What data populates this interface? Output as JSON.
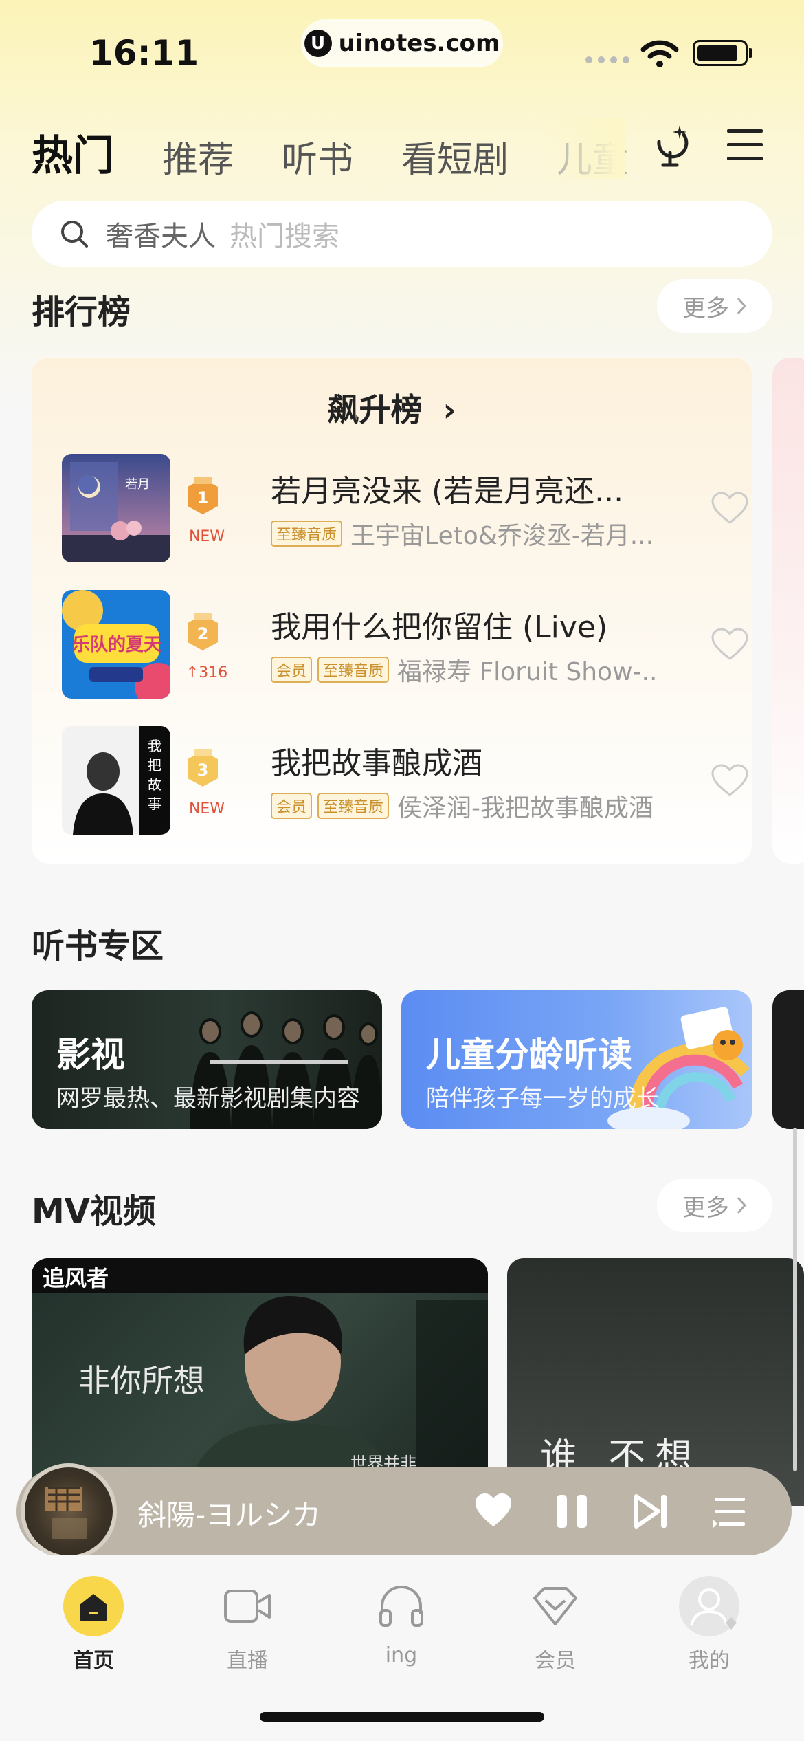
{
  "status_bar": {
    "time": "16:11",
    "url": "uinotes.com",
    "url_logo": "U"
  },
  "tabs": [
    {
      "label": "热门",
      "active": true
    },
    {
      "label": "推荐",
      "active": false
    },
    {
      "label": "听书",
      "active": false
    },
    {
      "label": "看短剧",
      "active": false
    },
    {
      "label": "儿童",
      "active": false
    }
  ],
  "search": {
    "keyword": "奢香夫人",
    "placeholder": "热门搜索"
  },
  "ranking": {
    "section_title": "排行榜",
    "more_label": "更多",
    "chart_title": "飙升榜",
    "chart_arrow": "›",
    "songs": [
      {
        "rank": "1",
        "rank_sub": "NEW",
        "title": "若月亮没来 (若是月亮还...",
        "tags": [
          "至臻音质"
        ],
        "artist": "王宇宙Leto&乔浚丞-若月..."
      },
      {
        "rank": "2",
        "rank_sub": "↑316",
        "title": "我用什么把你留住 (Live)",
        "tags": [
          "会员",
          "至臻音质"
        ],
        "artist": "福禄寿 Floruit Show-..."
      },
      {
        "rank": "3",
        "rank_sub": "NEW",
        "title": "我把故事酿成酒",
        "tags": [
          "会员",
          "至臻音质"
        ],
        "artist": "侯泽润-我把故事酿成酒"
      }
    ]
  },
  "audiobook": {
    "section_title": "听书专区",
    "cards": [
      {
        "title": "影视",
        "subtitle": "网罗最热、最新影视剧集内容"
      },
      {
        "title": "儿童分龄听读",
        "subtitle": "陪伴孩子每一岁的成长"
      }
    ]
  },
  "mv": {
    "section_title": "MV视频",
    "more_label": "更多",
    "cards": [
      {
        "corner_label": "追风者",
        "caption": "非你所想",
        "small_caption": "世界并非"
      },
      {
        "caption": "谁 不想"
      }
    ]
  },
  "player": {
    "song": "斜陽-ヨルシカ"
  },
  "bottom_nav": [
    {
      "label": "首页",
      "icon": "home-icon",
      "active": true
    },
    {
      "label": "直播",
      "icon": "video-camera-icon",
      "active": false
    },
    {
      "label": "ing",
      "icon": "headphones-icon",
      "active": false
    },
    {
      "label": "会员",
      "icon": "diamond-icon",
      "active": false
    },
    {
      "label": "我的",
      "icon": "avatar-icon",
      "active": false
    }
  ],
  "colors": {
    "accent": "#f8d74a",
    "tag": "#c9902b",
    "new_red": "#e0533b",
    "rank_gold": "#f09e3c"
  }
}
